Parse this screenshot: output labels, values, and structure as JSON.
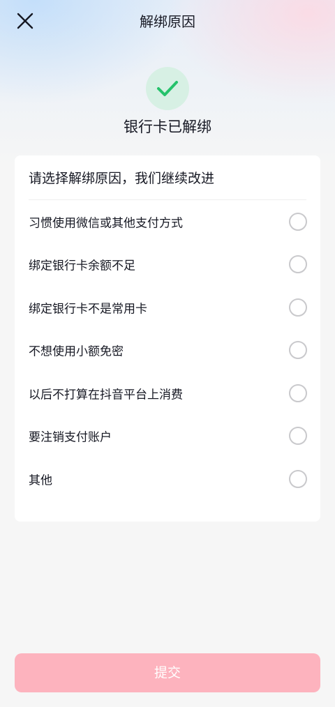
{
  "header": {
    "title": "解绑原因",
    "close_icon": "close-icon"
  },
  "status": {
    "icon": "check-icon",
    "icon_color": "#25c26b",
    "text": "银行卡已解绑"
  },
  "reasons": {
    "title": "请选择解绑原因，我们继续改进",
    "options": [
      {
        "label": "习惯使用微信或其他支付方式",
        "selected": false
      },
      {
        "label": "绑定银行卡余额不足",
        "selected": false
      },
      {
        "label": "绑定银行卡不是常用卡",
        "selected": false
      },
      {
        "label": "不想使用小额免密",
        "selected": false
      },
      {
        "label": "以后不打算在抖音平台上消费",
        "selected": false
      },
      {
        "label": "要注销支付账户",
        "selected": false
      },
      {
        "label": "其他",
        "selected": false
      }
    ]
  },
  "submit": {
    "label": "提交",
    "color": "#fdb3be",
    "enabled": false
  }
}
